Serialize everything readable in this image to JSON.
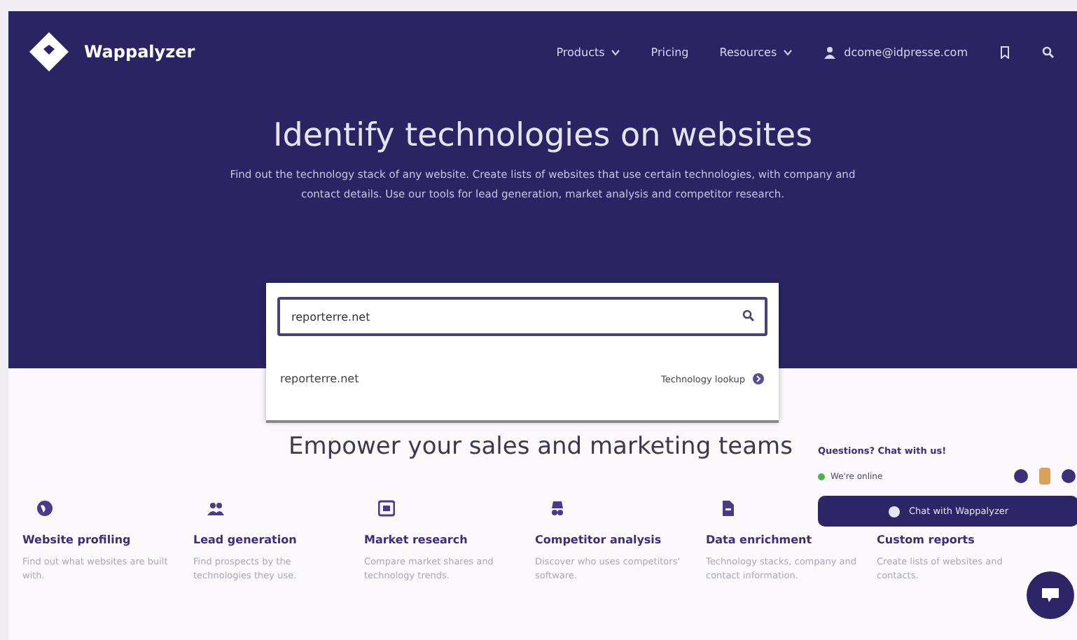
{
  "nav": {
    "brand": "Wappalyzer",
    "items": [
      {
        "label": "Products",
        "dropdown": true
      },
      {
        "label": "Pricing",
        "dropdown": false
      },
      {
        "label": "Resources",
        "dropdown": true
      }
    ],
    "account": "dcome@idpresse.com"
  },
  "hero": {
    "title": "Identify technologies on websites",
    "text": "Find out the technology stack of any website. Create lists of websites that use certain technologies, with company and contact details. Use our tools for lead generation, market analysis and competitor research."
  },
  "search": {
    "value": "reporterre.net",
    "suggestions": [
      {
        "text": "reporterre.net",
        "action": "Technology lookup"
      }
    ]
  },
  "section": {
    "title": "Empower your sales and marketing teams"
  },
  "features": [
    {
      "kind": "globe",
      "title": "Website profiling",
      "text": "Find out what websites are built with."
    },
    {
      "kind": "people",
      "title": "Lead generation",
      "text": "Find prospects by the technologies they use."
    },
    {
      "kind": "chart",
      "title": "Market research",
      "text": "Compare market shares and technology trends."
    },
    {
      "kind": "spy",
      "title": "Competitor analysis",
      "text": "Discover who uses competitors' software."
    },
    {
      "kind": "file",
      "title": "Data enrichment",
      "text": "Technology stacks, company and contact information."
    },
    {
      "kind": "none",
      "title": "Custom reports",
      "text": "Create lists of websites and contacts."
    }
  ],
  "chat": {
    "title": "Questions? Chat with us!",
    "status": "We're online",
    "online": true,
    "button": "Chat with Wappalyzer"
  }
}
